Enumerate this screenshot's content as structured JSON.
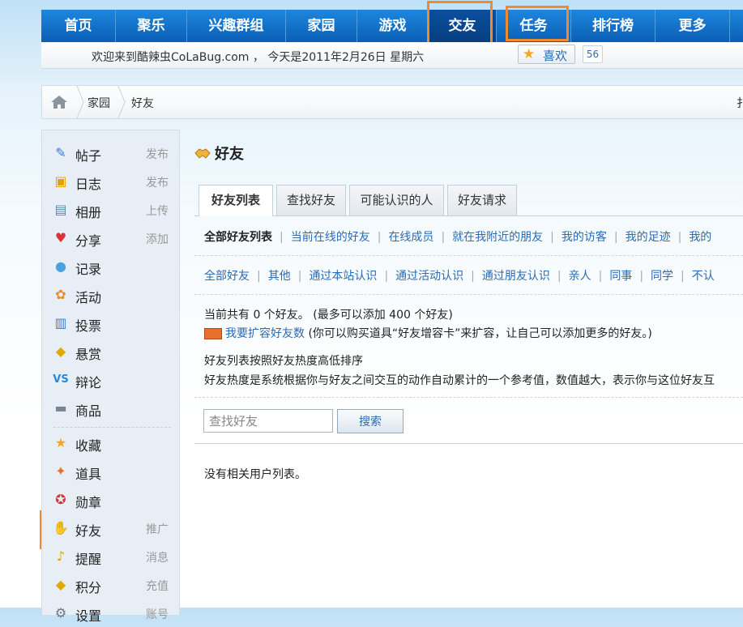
{
  "nav": {
    "items": [
      "首页",
      "聚乐",
      "兴趣群组",
      "家园",
      "游戏",
      "交友",
      "任务",
      "排行榜",
      "更多"
    ],
    "active": "交友"
  },
  "welcome": {
    "text": "欢迎来到酷辣虫CoLaBug.com ， 今天是2011年2月26日 星期六",
    "like_label": "喜欢",
    "like_count": "56"
  },
  "breadcrumb": {
    "items": [
      "家园",
      "好友"
    ],
    "cut_text": "扌"
  },
  "sidebar": {
    "items": [
      {
        "icon": "post-icon",
        "label": "帖子",
        "action": "发布"
      },
      {
        "icon": "blog-icon",
        "label": "日志",
        "action": "发布"
      },
      {
        "icon": "album-icon",
        "label": "相册",
        "action": "上传"
      },
      {
        "icon": "share-icon",
        "label": "分享",
        "action": "添加"
      },
      {
        "icon": "record-icon",
        "label": "记录",
        "action": ""
      },
      {
        "icon": "activity-icon",
        "label": "活动",
        "action": ""
      },
      {
        "icon": "poll-icon",
        "label": "投票",
        "action": ""
      },
      {
        "icon": "reward-icon",
        "label": "悬赏",
        "action": ""
      },
      {
        "icon": "debate-icon",
        "label": "辩论",
        "action": ""
      },
      {
        "icon": "goods-icon",
        "label": "商品",
        "action": ""
      },
      {
        "icon": "favorite-icon",
        "label": "收藏",
        "action": ""
      },
      {
        "icon": "prop-icon",
        "label": "道具",
        "action": ""
      },
      {
        "icon": "medal-icon",
        "label": "勋章",
        "action": ""
      },
      {
        "icon": "friends-icon",
        "label": "好友",
        "action": "推广"
      },
      {
        "icon": "reminder-icon",
        "label": "提醒",
        "action": "消息"
      },
      {
        "icon": "credits-icon",
        "label": "积分",
        "action": "充值"
      },
      {
        "icon": "settings-icon",
        "label": "设置",
        "action": "账号"
      }
    ]
  },
  "main": {
    "title": "好友",
    "tabs": [
      "好友列表",
      "查找好友",
      "可能认识的人",
      "好友请求"
    ],
    "filter_row1": [
      "全部好友列表",
      "当前在线的好友",
      "在线成员",
      "就在我附近的朋友",
      "我的访客",
      "我的足迹",
      "我的"
    ],
    "filter_row2": [
      "全部好友",
      "其他",
      "通过本站认识",
      "通过活动认识",
      "通过朋友认识",
      "亲人",
      "同事",
      "同学",
      "不认"
    ],
    "count_text": "当前共有 0 个好友。 (最多可以添加 400 个好友)",
    "expand_link": "我要扩容好友数",
    "expand_note": " (你可以购买道具“好友增容卡”来扩容，让自己可以添加更多的好友。)",
    "sort_text": "好友列表按照好友热度高低排序",
    "heat_text": "好友热度是系统根据你与好友之间交互的动作自动累计的一个参考值，数值越大，表示你与这位好友互",
    "search_placeholder": "查找好友",
    "search_button": "搜索",
    "empty_text": "没有相关用户列表。"
  },
  "colors": {
    "nav_blue": "#0a6fc8",
    "highlight": "#f08a2f",
    "link": "#2a6bb3"
  }
}
